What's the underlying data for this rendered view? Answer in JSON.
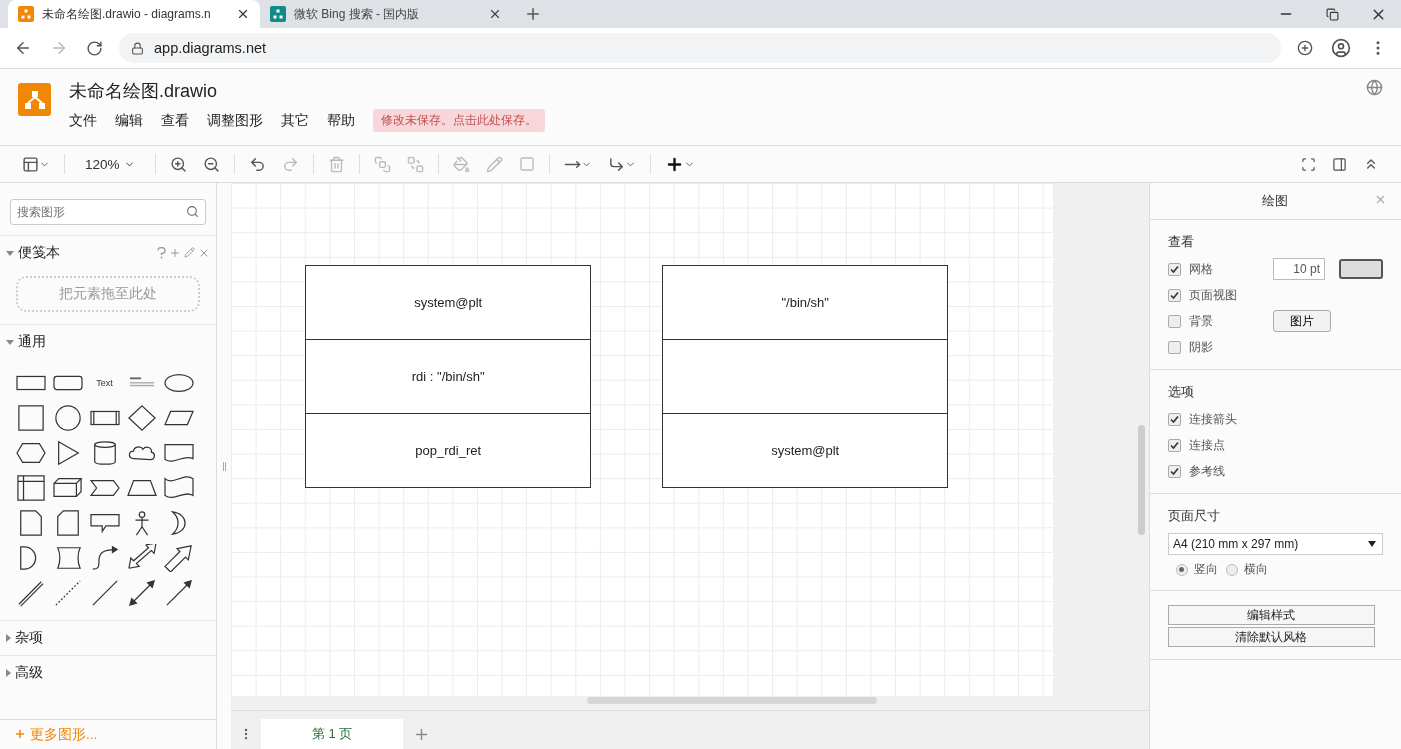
{
  "browser": {
    "tabs": [
      {
        "title": "未命名绘图.drawio - diagrams.n",
        "selected": true,
        "kind": "drawio"
      },
      {
        "title": "微软 Bing 搜索 - 国内版",
        "selected": false,
        "kind": "bing"
      }
    ],
    "url": "app.diagrams.net"
  },
  "app": {
    "title": "未命名绘图.drawio",
    "menus": [
      "文件",
      "编辑",
      "查看",
      "调整图形",
      "其它",
      "帮助"
    ],
    "save_notice": "修改未保存。点击此处保存。"
  },
  "toolbar": {
    "zoom": "120%"
  },
  "sidebar": {
    "search": {
      "placeholder": "搜索图形"
    },
    "sections": [
      {
        "kind": "scratchpad",
        "title": "便笺本",
        "expanded": true,
        "hint": "把元素拖至此处"
      },
      {
        "kind": "shapes",
        "title": "通用",
        "expanded": true,
        "text_shape": "Text"
      },
      {
        "kind": "plain",
        "title": "杂项",
        "expanded": false
      },
      {
        "kind": "plain",
        "title": "高级",
        "expanded": false
      }
    ],
    "more_shapes": "更多图形..."
  },
  "canvas": {
    "stacks": [
      {
        "cells": [
          {
            "text": "system@plt"
          },
          {
            "text": "rdi : \"/bin/sh\""
          },
          {
            "text": "pop_rdi_ret"
          }
        ]
      },
      {
        "cells": [
          {
            "text": "\"/bin/sh\""
          },
          {},
          {
            "text": "system@plt"
          }
        ]
      }
    ],
    "pages": [
      {
        "label": "第 1 页",
        "selected": true
      }
    ]
  },
  "format_panel": {
    "title": "绘图",
    "sections": [
      {
        "title": "查看",
        "options": [
          {
            "label": "网格",
            "checked": true,
            "kind": "grid",
            "value": "10 pt"
          },
          {
            "label": "页面视图",
            "checked": true,
            "kind": "plain"
          },
          {
            "label": "背景",
            "checked": false,
            "kind": "image",
            "button": "图片"
          },
          {
            "label": "阴影",
            "checked": false,
            "kind": "plain"
          }
        ]
      },
      {
        "title": "选项",
        "options": [
          {
            "label": "连接箭头",
            "checked": true,
            "kind": "plain"
          },
          {
            "label": "连接点",
            "checked": true,
            "kind": "plain"
          },
          {
            "label": "参考线",
            "checked": true,
            "kind": "plain"
          }
        ]
      }
    ],
    "page_size": {
      "title": "页面尺寸",
      "value": "A4 (210 mm x 297 mm)",
      "orientations": [
        {
          "label": "竖向",
          "selected": true
        },
        {
          "label": "横向",
          "selected": false
        }
      ]
    },
    "buttons": [
      "编辑样式",
      "清除默认风格"
    ]
  }
}
